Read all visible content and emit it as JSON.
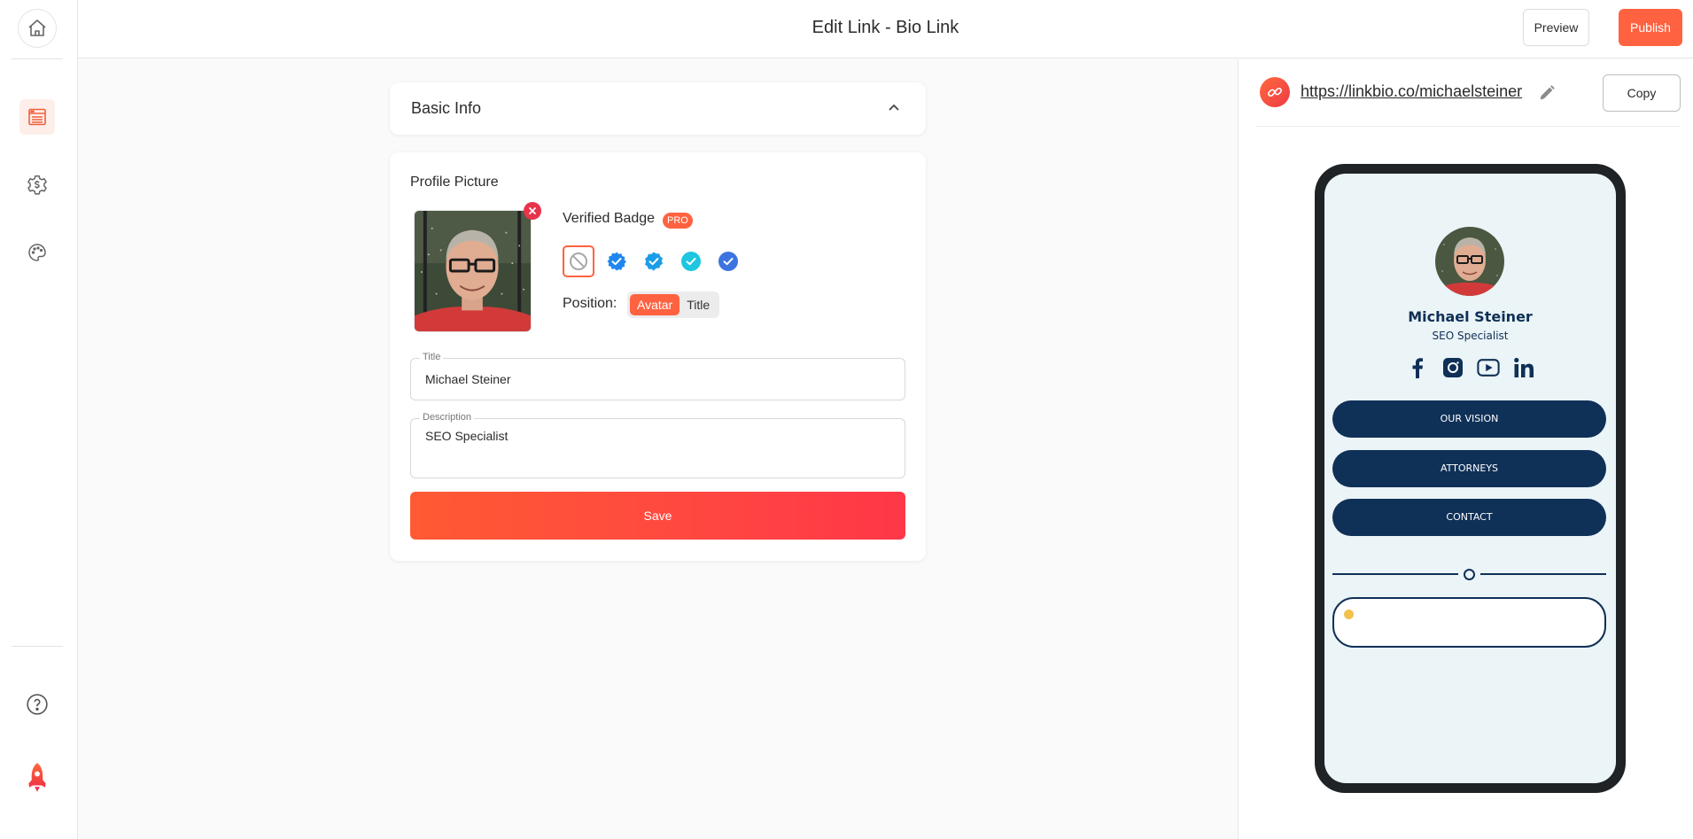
{
  "header": {
    "title": "Edit Link - Bio Link",
    "preview_label": "Preview",
    "publish_label": "Publish"
  },
  "sidebar": {
    "top": {
      "icon": "home-icon",
      "label": "Home"
    },
    "items": [
      {
        "icon": "page-layout-icon",
        "label": "Edit Page",
        "active": true
      },
      {
        "icon": "dollar-gear-icon",
        "label": "Settings",
        "active": false
      },
      {
        "icon": "palette-icon",
        "label": "Appearance",
        "active": false
      }
    ],
    "bottom": [
      {
        "icon": "help-icon",
        "label": "Help"
      },
      {
        "icon": "rocket-icon",
        "label": "Upgrade"
      }
    ]
  },
  "editor": {
    "accordion": {
      "title": "Basic Info",
      "expanded": true
    },
    "profile": {
      "section_label": "Profile Picture",
      "avatar_alt": "Profile photo of Michael Steiner",
      "verified_badge": {
        "label": "Verified Badge",
        "pro_label": "PRO",
        "options": [
          {
            "icon": "no-badge-icon",
            "color": "#a9a9a9",
            "selected": true
          },
          {
            "icon": "verified-star-icon",
            "color": "#1f86f0",
            "selected": false
          },
          {
            "icon": "verified-star-icon",
            "color": "#1a9de8",
            "selected": false
          },
          {
            "icon": "verified-circle-icon",
            "color": "#1ec6e0",
            "selected": false
          },
          {
            "icon": "verified-circle-icon",
            "color": "#3b74e0",
            "selected": false
          }
        ]
      },
      "position": {
        "label": "Position:",
        "options": [
          "Avatar",
          "Title"
        ],
        "selected": "Avatar"
      }
    },
    "fields": {
      "title": {
        "label": "Title",
        "value": "Michael Steiner"
      },
      "description": {
        "label": "Description",
        "value": "SEO Specialist"
      }
    },
    "save_label": "Save"
  },
  "preview_panel": {
    "url": "https://linkbio.co/michaelsteiner",
    "copy_label": "Copy",
    "phone": {
      "name": "Michael Steiner",
      "description": "SEO Specialist",
      "socials": [
        "facebook",
        "instagram",
        "youtube",
        "linkedin"
      ],
      "buttons": [
        "OUR VISION",
        "ATTORNEYS",
        "CONTACT"
      ],
      "theme_color": "#0f3057",
      "background_color": "#ebf4f7"
    }
  },
  "colors": {
    "accent": "#ff6240",
    "danger": "#e8344a"
  }
}
